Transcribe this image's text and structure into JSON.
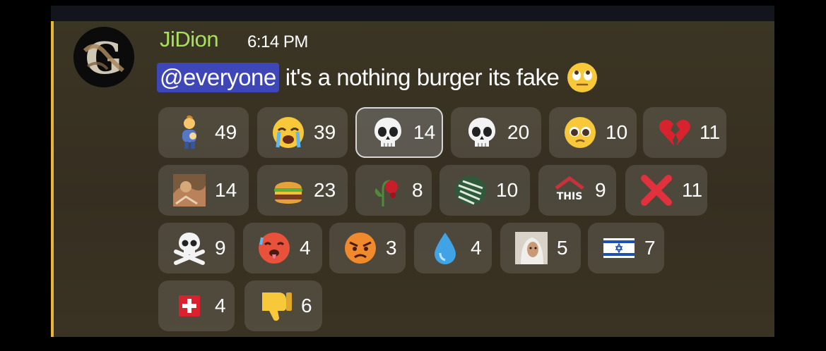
{
  "message": {
    "author": "JiDion",
    "timestamp": "6:14 PM",
    "mention": "@everyone",
    "text": "it's a nothing burger its fake",
    "trailing_emoji": "face-with-rolling-eyes",
    "highlight_color": "#e7b43c"
  },
  "reactions": [
    {
      "emoji": "person-feeding-baby-emoji",
      "count": "49",
      "active": false
    },
    {
      "emoji": "loudly-crying-face-emoji",
      "count": "39",
      "active": false
    },
    {
      "emoji": "skull-emoji",
      "count": "14",
      "active": true
    },
    {
      "emoji": "skull-emoji",
      "count": "20",
      "active": false
    },
    {
      "emoji": "pleading-face-emoji",
      "count": "10",
      "active": false
    },
    {
      "emoji": "broken-heart-emoji",
      "count": "11",
      "active": false
    },
    {
      "emoji": "custom-photo-emoji",
      "count": "14",
      "active": false
    },
    {
      "emoji": "hamburger-emoji",
      "count": "23",
      "active": false
    },
    {
      "emoji": "wilted-rose-emoji",
      "count": "8",
      "active": false
    },
    {
      "emoji": "custom-green-pattern-emoji",
      "count": "10",
      "active": false
    },
    {
      "emoji": "this-arrow-emoji",
      "count": "9",
      "active": false,
      "label": "THIS"
    },
    {
      "emoji": "cross-mark-emoji",
      "count": "11",
      "active": false
    },
    {
      "emoji": "skull-and-crossbones-emoji",
      "count": "9",
      "active": false
    },
    {
      "emoji": "hot-face-emoji",
      "count": "4",
      "active": false
    },
    {
      "emoji": "angry-face-emoji",
      "count": "3",
      "active": false
    },
    {
      "emoji": "droplet-emoji",
      "count": "4",
      "active": false
    },
    {
      "emoji": "custom-selfie-emoji",
      "count": "5",
      "active": false
    },
    {
      "emoji": "flag-israel-emoji",
      "count": "7",
      "active": false
    },
    {
      "emoji": "flag-switzerland-emoji",
      "count": "4",
      "active": false
    },
    {
      "emoji": "thumbs-down-emoji",
      "count": "6",
      "active": false
    }
  ]
}
